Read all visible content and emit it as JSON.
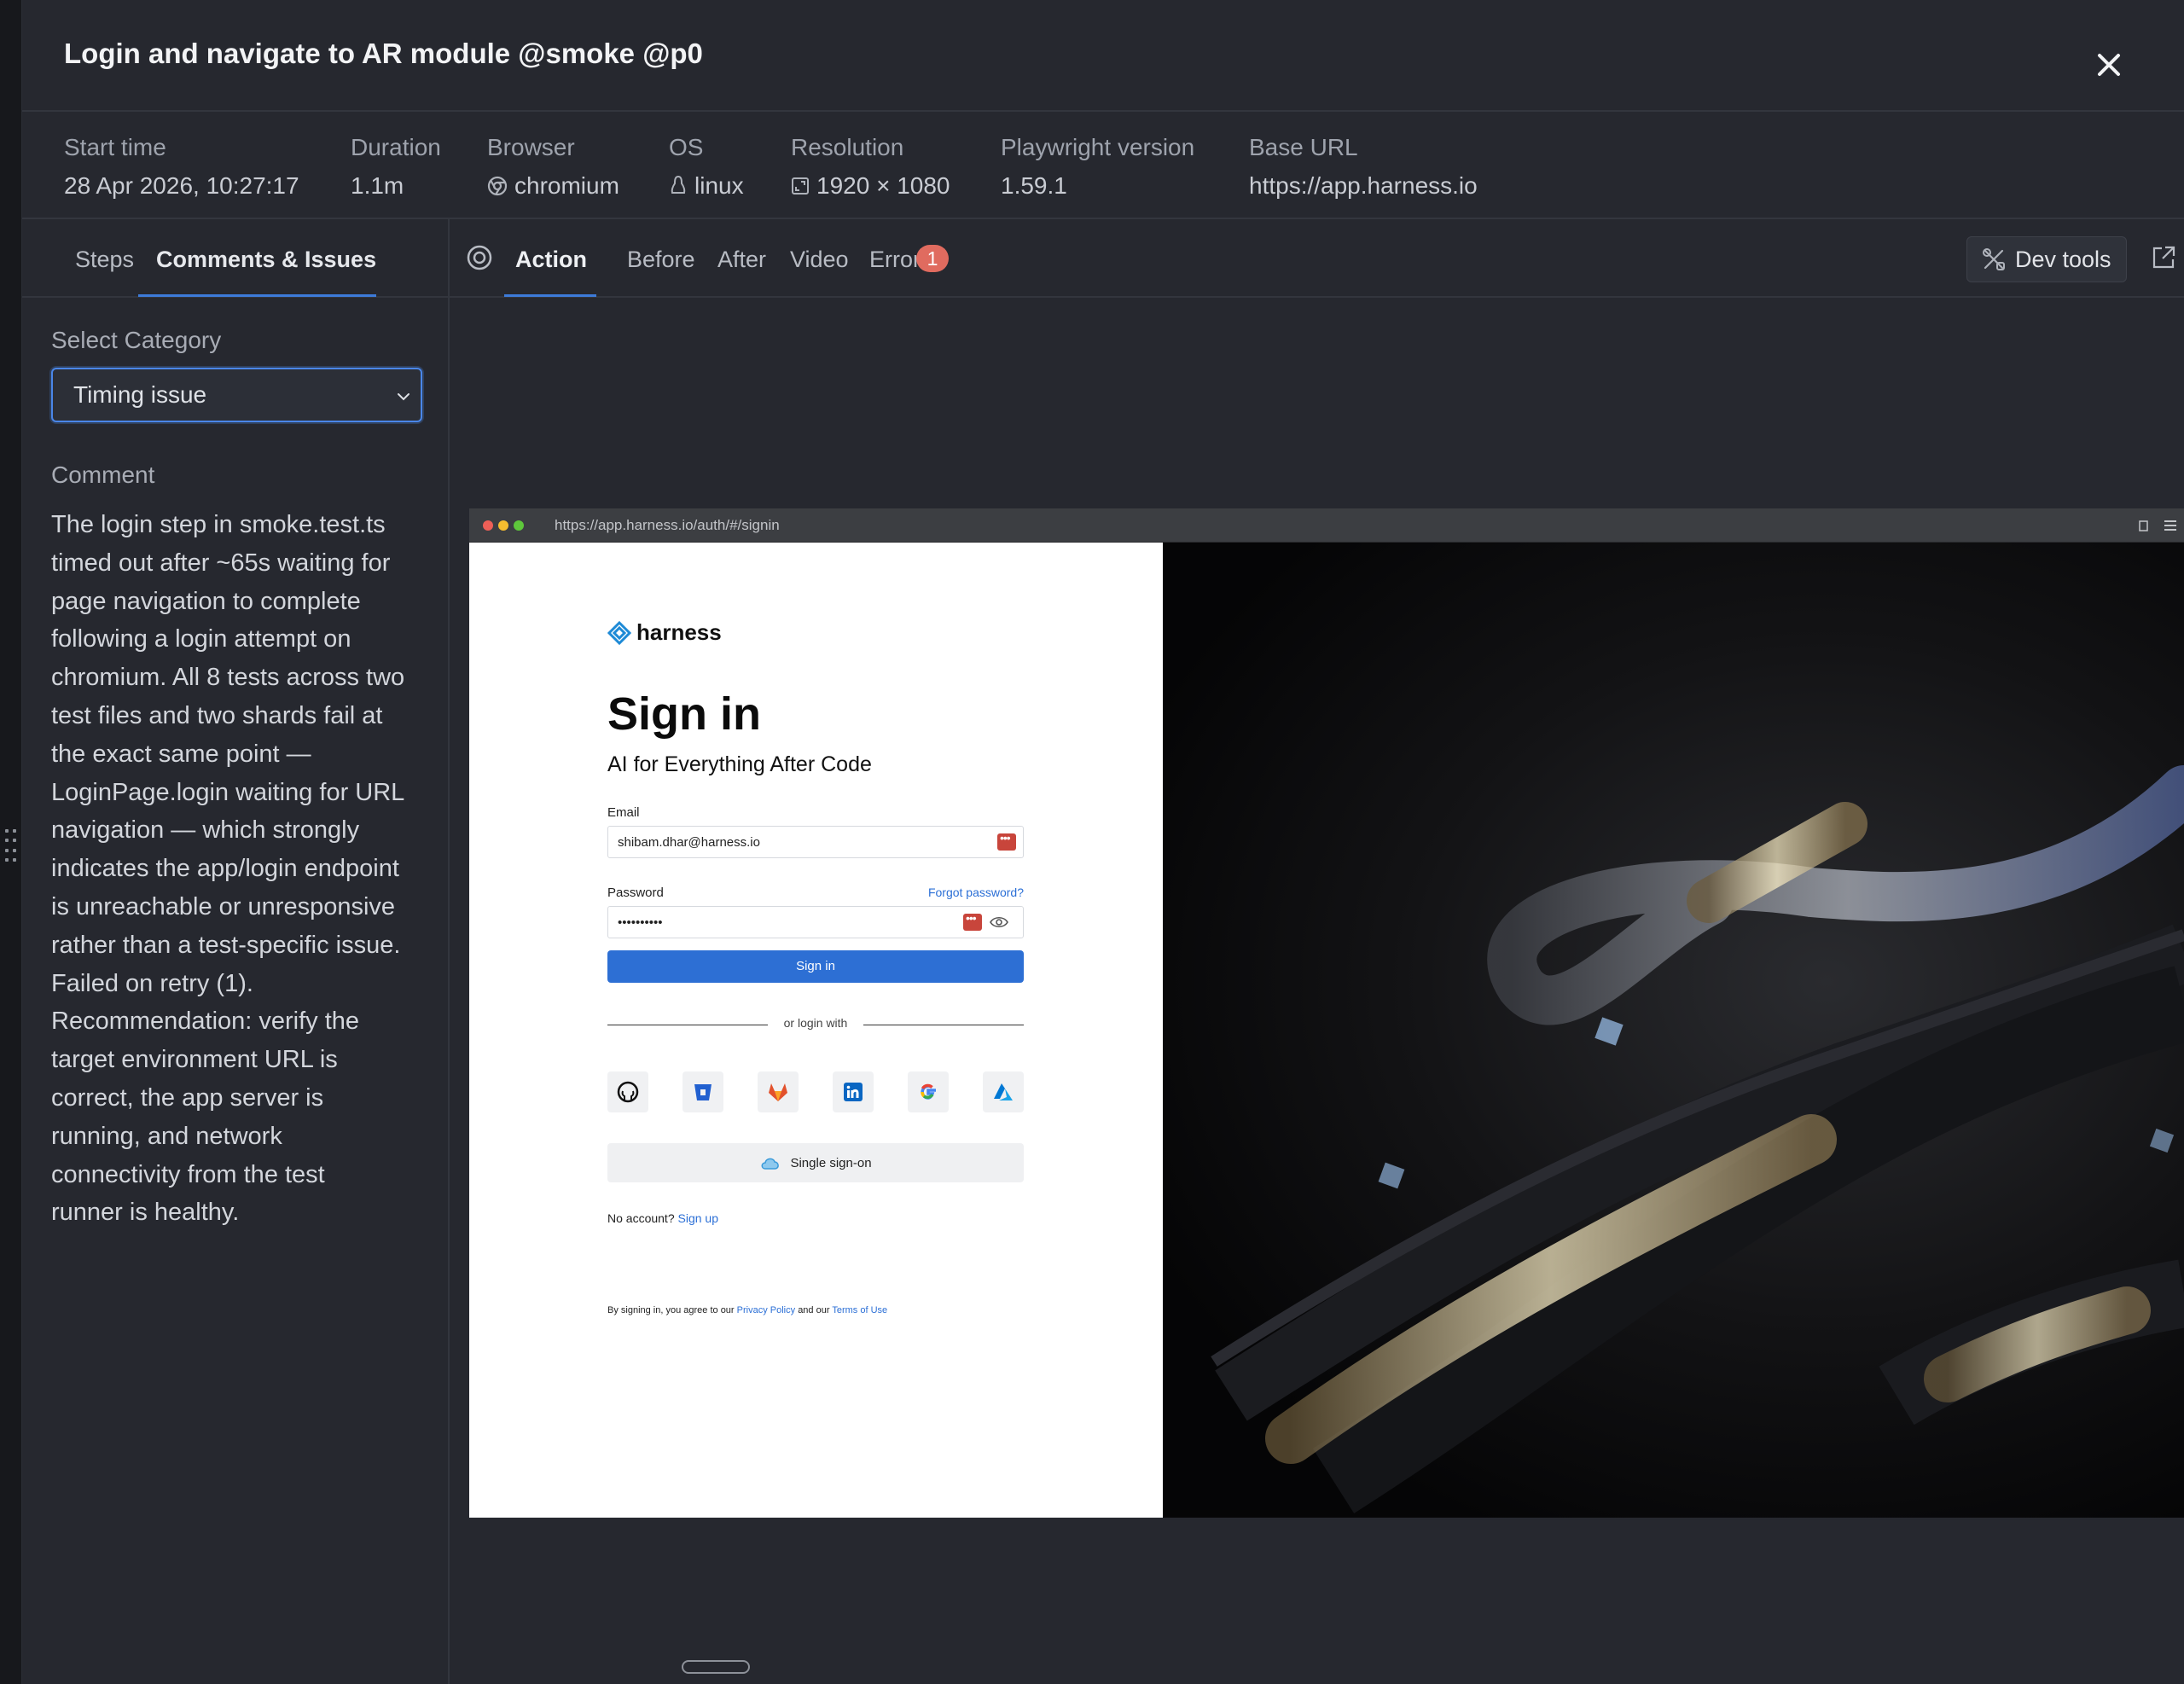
{
  "header": {
    "title": "Login and navigate to AR module @smoke @p0"
  },
  "meta": [
    {
      "label": "Start time",
      "value": "28 Apr 2026, 10:27:17",
      "icon": ""
    },
    {
      "label": "Duration",
      "value": "1.1m",
      "icon": ""
    },
    {
      "label": "Browser",
      "value": "chromium",
      "icon": "chromium-icon"
    },
    {
      "label": "OS",
      "value": "linux",
      "icon": "linux-icon"
    },
    {
      "label": "Resolution",
      "value": "1920 × 1080",
      "icon": "resolution-icon"
    },
    {
      "label": "Playwright version",
      "value": "1.59.1",
      "icon": ""
    },
    {
      "label": "Base URL",
      "value": "https://app.harness.io",
      "icon": ""
    }
  ],
  "sidebar": {
    "tabs": [
      "Steps",
      "Comments & Issues"
    ],
    "active_tab": "Comments & Issues",
    "select_label": "Select Category",
    "select_value": "Timing issue",
    "comment_label": "Comment",
    "comment_lines": [
      "The login step in smoke.test.ts",
      "timed out after ~65s waiting for",
      "page navigation to complete",
      "following a login attempt on",
      "chromium. All 8 tests across two",
      "test files and two shards fail at",
      "the exact same point —",
      "LoginPage.login waiting for URL",
      "navigation — which strongly",
      "indicates the app/login endpoint",
      "is unreachable or unresponsive",
      "rather than a test-specific issue.",
      "Failed on retry (1).",
      "Recommendation: verify the",
      "target environment URL is",
      "correct, the app server is",
      "running, and network",
      "connectivity from the test",
      "runner is healthy."
    ]
  },
  "viewer": {
    "tabs": [
      "Action",
      "Before",
      "After",
      "Video",
      "Errors"
    ],
    "active_tab": "Action",
    "error_count": "1",
    "devtools_label": "Dev tools"
  },
  "screenshot": {
    "url": "https://app.harness.io/auth/#/signin",
    "logo_text": "harness",
    "title": "Sign in",
    "subtitle": "AI for Everything After Code",
    "email_label": "Email",
    "email_value": "shibam.dhar@harness.io",
    "password_label": "Password",
    "forgot_label": "Forgot password?",
    "password_value": "••••••••••",
    "signin_label": "Sign in",
    "or_label": "or login with",
    "social_icons": [
      "github-icon",
      "bitbucket-icon",
      "gitlab-icon",
      "linkedin-icon",
      "google-icon",
      "azure-icon"
    ],
    "sso_label": "Single sign-on",
    "no_account": "No account?",
    "signup_label": "Sign up",
    "terms_prefix": "By signing in, you agree to our",
    "privacy_label": "Privacy Policy",
    "terms_mid": "and our",
    "terms_label": "Terms of Use"
  }
}
